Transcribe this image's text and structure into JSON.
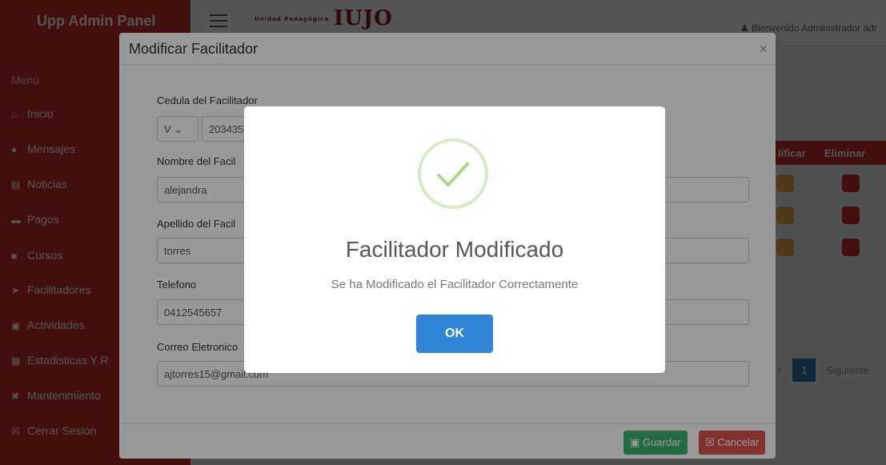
{
  "topbar": {
    "brand": "Upp Admin Panel",
    "logo_small": "Unidad Pedagógica",
    "logo_text": "IUJO",
    "welcome": "Bienvenido Administrador adr"
  },
  "sidebar": {
    "menu_label": "Menú",
    "items": [
      {
        "label": "Inicio",
        "icon": "home-icon"
      },
      {
        "label": "Mensajes",
        "icon": "comment-icon"
      },
      {
        "label": "Noticias",
        "icon": "newspaper-icon"
      },
      {
        "label": "Pagos",
        "icon": "card-icon"
      },
      {
        "label": "Cursos",
        "icon": "book-icon"
      },
      {
        "label": "Facilitadores",
        "icon": "user-icon"
      },
      {
        "label": "Actividades",
        "icon": "calendar-icon"
      },
      {
        "label": "Estadisticas Y R",
        "icon": "chart-icon"
      },
      {
        "label": "Mantenimiento",
        "icon": "wrench-icon"
      },
      {
        "label": "Cerrar Sesión",
        "icon": "logout-icon"
      }
    ]
  },
  "table": {
    "col_modify": "lificar",
    "col_delete": "Eliminar"
  },
  "pager": {
    "prev_fragment": "r",
    "page": "1",
    "next": "Siguiente"
  },
  "modal": {
    "title": "Modificar Facilitador",
    "close": "×",
    "fields": {
      "cedula_label": "Cedula del Facilitador",
      "cedula_type": "V",
      "cedula_value": "203435",
      "nombre_label": "Nombre del Facil",
      "nombre_value": "alejandra",
      "apellido_label": "Apellido del Facil",
      "apellido_value": "torres",
      "telefono_label": "Telefono",
      "telefono_value": "0412545657",
      "correo_label": "Correo Eletronico",
      "correo_value": "ajtorres15@gmail.com"
    },
    "save_label": "Guardar",
    "cancel_label": "Cancelar"
  },
  "alert": {
    "title": "Facilitador Modificado",
    "text": "Se ha Modificado el Facilitador Correctamente",
    "ok_label": "OK"
  },
  "colors": {
    "brand": "#c9302c",
    "success": "#a5dc86",
    "ok_button": "#3085d6"
  }
}
